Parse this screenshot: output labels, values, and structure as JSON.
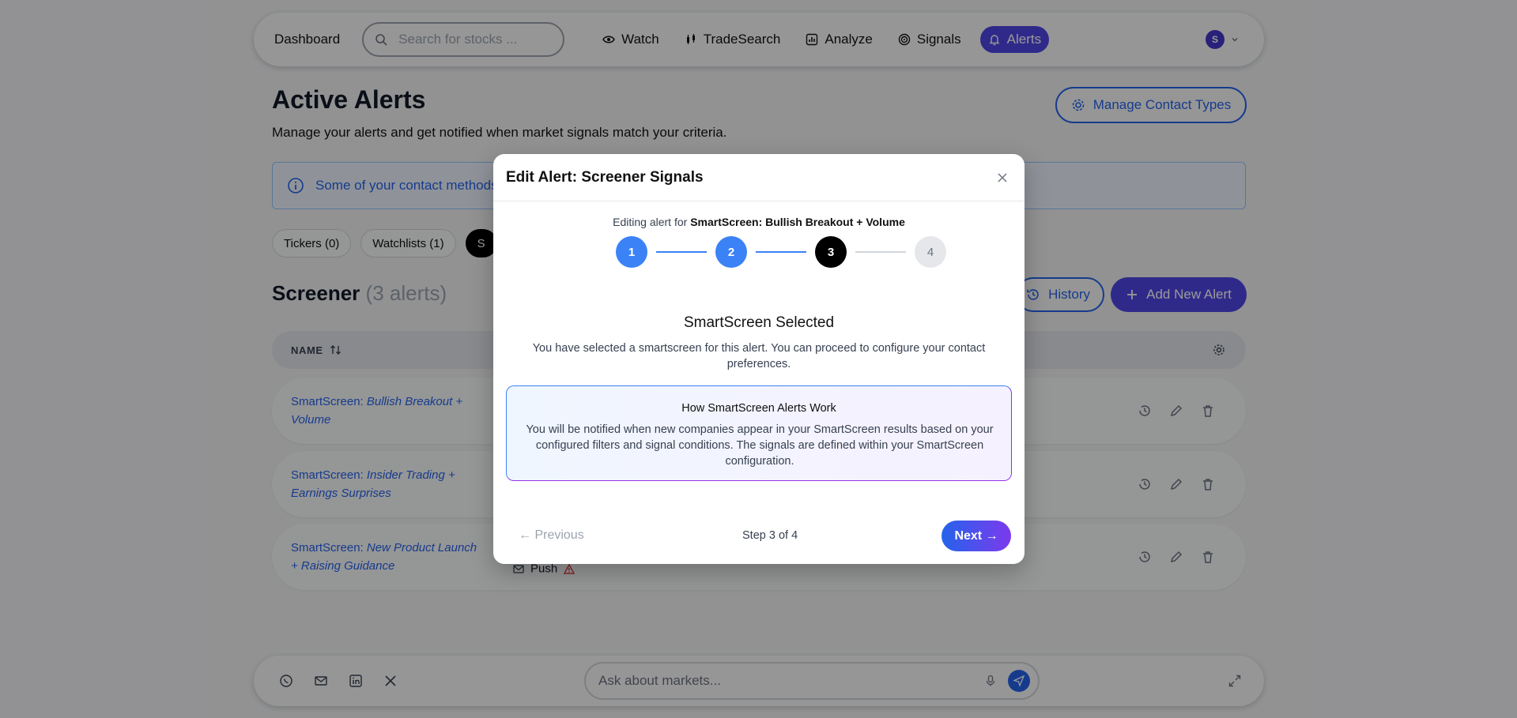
{
  "nav": {
    "brand": "Dashboard",
    "search_placeholder": "Search for stocks ...",
    "items": [
      {
        "label": "Watch",
        "icon": "eye-icon"
      },
      {
        "label": "TradeSearch",
        "icon": "candlestick-icon"
      },
      {
        "label": "Analyze",
        "icon": "chart-icon"
      },
      {
        "label": "Signals",
        "icon": "target-icon"
      },
      {
        "label": "Alerts",
        "icon": "bell-icon",
        "active": true
      }
    ],
    "user_initial": "S"
  },
  "header": {
    "title": "Active Alerts",
    "subtitle": "Manage your alerts and get notified when market signals match your criteria.",
    "manage_button": "Manage Contact Types"
  },
  "banner": {
    "text": "Some of your contact methods"
  },
  "filters": [
    "Tickers (0)",
    "Watchlists (1)",
    "S"
  ],
  "section": {
    "title": "Screener",
    "count": "(3 alerts)",
    "history_button": "History",
    "add_button": "Add New Alert"
  },
  "table": {
    "name_header": "NAME",
    "rows": [
      {
        "prefix": "SmartScreen:",
        "name": "Bullish Breakout + Volume",
        "contact": ""
      },
      {
        "prefix": "SmartScreen:",
        "name": "Insider Trading + Earnings Surprises",
        "contact": ""
      },
      {
        "prefix": "SmartScreen:",
        "name": "New Product Launch + Raising Guidance",
        "contact": "Push"
      }
    ]
  },
  "bottom": {
    "ask_placeholder": "Ask about markets..."
  },
  "modal": {
    "title": "Edit Alert: Screener Signals",
    "editing_prefix": "Editing alert for",
    "editing_target": "SmartScreen: Bullish Breakout + Volume",
    "steps": [
      "1",
      "2",
      "3",
      "4"
    ],
    "current_step": 3,
    "selected_title": "SmartScreen Selected",
    "selected_desc": "You have selected a smartscreen for this alert. You can proceed to configure your contact preferences.",
    "how_title": "How SmartScreen Alerts Work",
    "how_desc": "You will be notified when new companies appear in your SmartScreen results based on your configured filters and signal conditions. The signals are defined within your SmartScreen configuration.",
    "previous": "← Previous",
    "step_label": "Step 3 of 4",
    "next": "Next →"
  },
  "colors": {
    "accent": "#4f46e5",
    "link": "#2563eb",
    "step_done": "#3b82f6",
    "step_current": "#000000",
    "warning": "#dc2626"
  }
}
